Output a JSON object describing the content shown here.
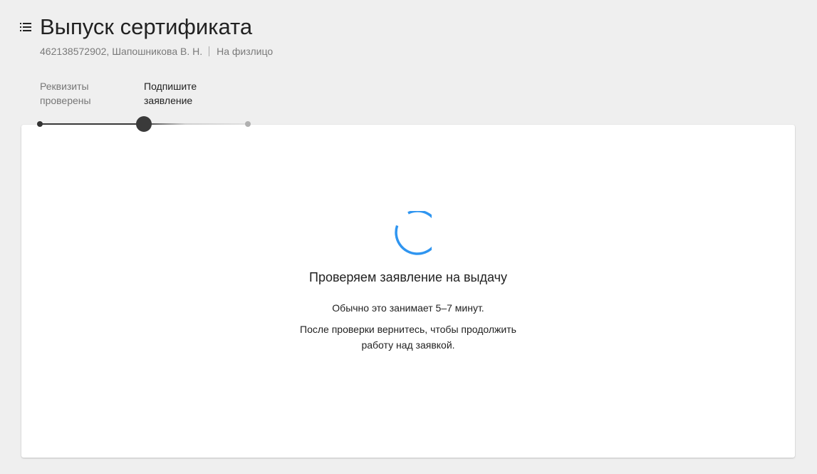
{
  "header": {
    "menu_icon": "list-icon",
    "title": "Выпуск сертификата",
    "subtitle_id_name": "462138572902, Шапошникова В. Н.",
    "subtitle_type": "На физлицо"
  },
  "stepper": {
    "steps": [
      {
        "label_line1": "Реквизиты",
        "label_line2": "проверены",
        "status": "done"
      },
      {
        "label_line1": "Подпишите",
        "label_line2": "заявление",
        "status": "current"
      },
      {
        "label_line1": "",
        "label_line2": "",
        "status": "pending"
      }
    ]
  },
  "status_card": {
    "spinner_icon": "loading-spinner-icon",
    "title": "Проверяем заявление на выдачу",
    "text_duration": "Обычно это занимает 5–7 минут.",
    "text_return_line1": "После проверки вернитесь, чтобы продолжить",
    "text_return_line2": "работу над заявкой."
  },
  "colors": {
    "background": "#efefef",
    "card": "#ffffff",
    "spinner": "#2f95f0",
    "stepper_active": "#3a3a3a",
    "stepper_pending": "#b0b0b0",
    "muted_text": "#7a7a7a"
  }
}
